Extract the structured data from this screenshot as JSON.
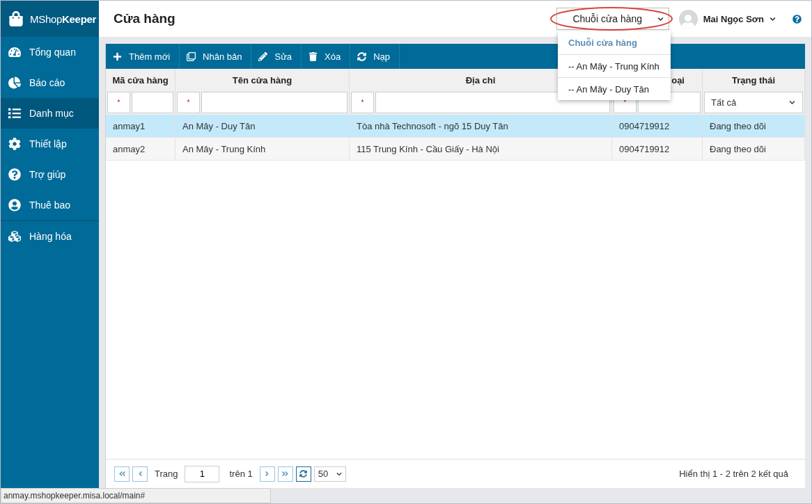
{
  "app": {
    "logo_light": "MShop",
    "logo_bold": "Keeper"
  },
  "sidebar": {
    "items": [
      {
        "label": "Tổng quan",
        "selected": false
      },
      {
        "label": "Báo cáo",
        "selected": false
      },
      {
        "label": "Danh mục",
        "selected": true
      },
      {
        "label": "Thiết lập",
        "selected": false
      },
      {
        "label": "Trợ giúp",
        "selected": false
      },
      {
        "label": "Thuê bao",
        "selected": false
      },
      {
        "label": "Hàng hóa",
        "selected": false
      }
    ]
  },
  "header": {
    "title": "Cửa hàng",
    "store_select": {
      "value": "Chuỗi cửa hàng",
      "open": true,
      "highlighted": true
    },
    "user": {
      "name": "Mai Ngọc Sơn"
    }
  },
  "store_menu": {
    "items": [
      {
        "label": "Chuỗi cửa hàng",
        "kind": "heading"
      },
      {
        "label": "-- An Mây - Trung Kính",
        "kind": "option"
      },
      {
        "label": "-- An Mây - Duy Tân",
        "kind": "option"
      }
    ]
  },
  "toolbar": {
    "buttons": [
      {
        "label": "Thêm mới"
      },
      {
        "label": "Nhân bản"
      },
      {
        "label": "Sửa"
      },
      {
        "label": "Xóa"
      },
      {
        "label": "Nạp"
      }
    ]
  },
  "table": {
    "columns": [
      {
        "label": "Mã cửa hàng",
        "filter": {
          "kind": "text",
          "operator": "*"
        }
      },
      {
        "label": "Tên cửa hàng",
        "filter": {
          "kind": "text",
          "operator": "*"
        }
      },
      {
        "label": "Địa chỉ",
        "filter": {
          "kind": "text",
          "operator": "*"
        }
      },
      {
        "label": "oại",
        "clipped": true,
        "filter": {
          "kind": "text",
          "operator": "*"
        }
      },
      {
        "label": "Trạng thái",
        "filter": {
          "kind": "select",
          "value": "Tất cả"
        }
      }
    ],
    "rows": [
      {
        "selected": true,
        "cells": [
          "anmay1",
          "An Mây - Duy Tân",
          "Tòa nhà Technosoft - ngõ 15 Duy Tân",
          "0904719912",
          "Đang theo dõi"
        ]
      },
      {
        "selected": false,
        "cells": [
          "anmay2",
          "An Mây - Trung Kính",
          "115 Trung Kính - Cầu Giấy - Hà Nội",
          "0904719912",
          "Đang theo dõi"
        ]
      }
    ]
  },
  "pager": {
    "label": "Trang",
    "page": "1",
    "of": "trên 1",
    "page_size": "50",
    "summary": "Hiển thị 1 - 2 trên 2 kết quả"
  },
  "status_bar": {
    "url": "anmay.mshopkeeper.misa.local/main#"
  }
}
